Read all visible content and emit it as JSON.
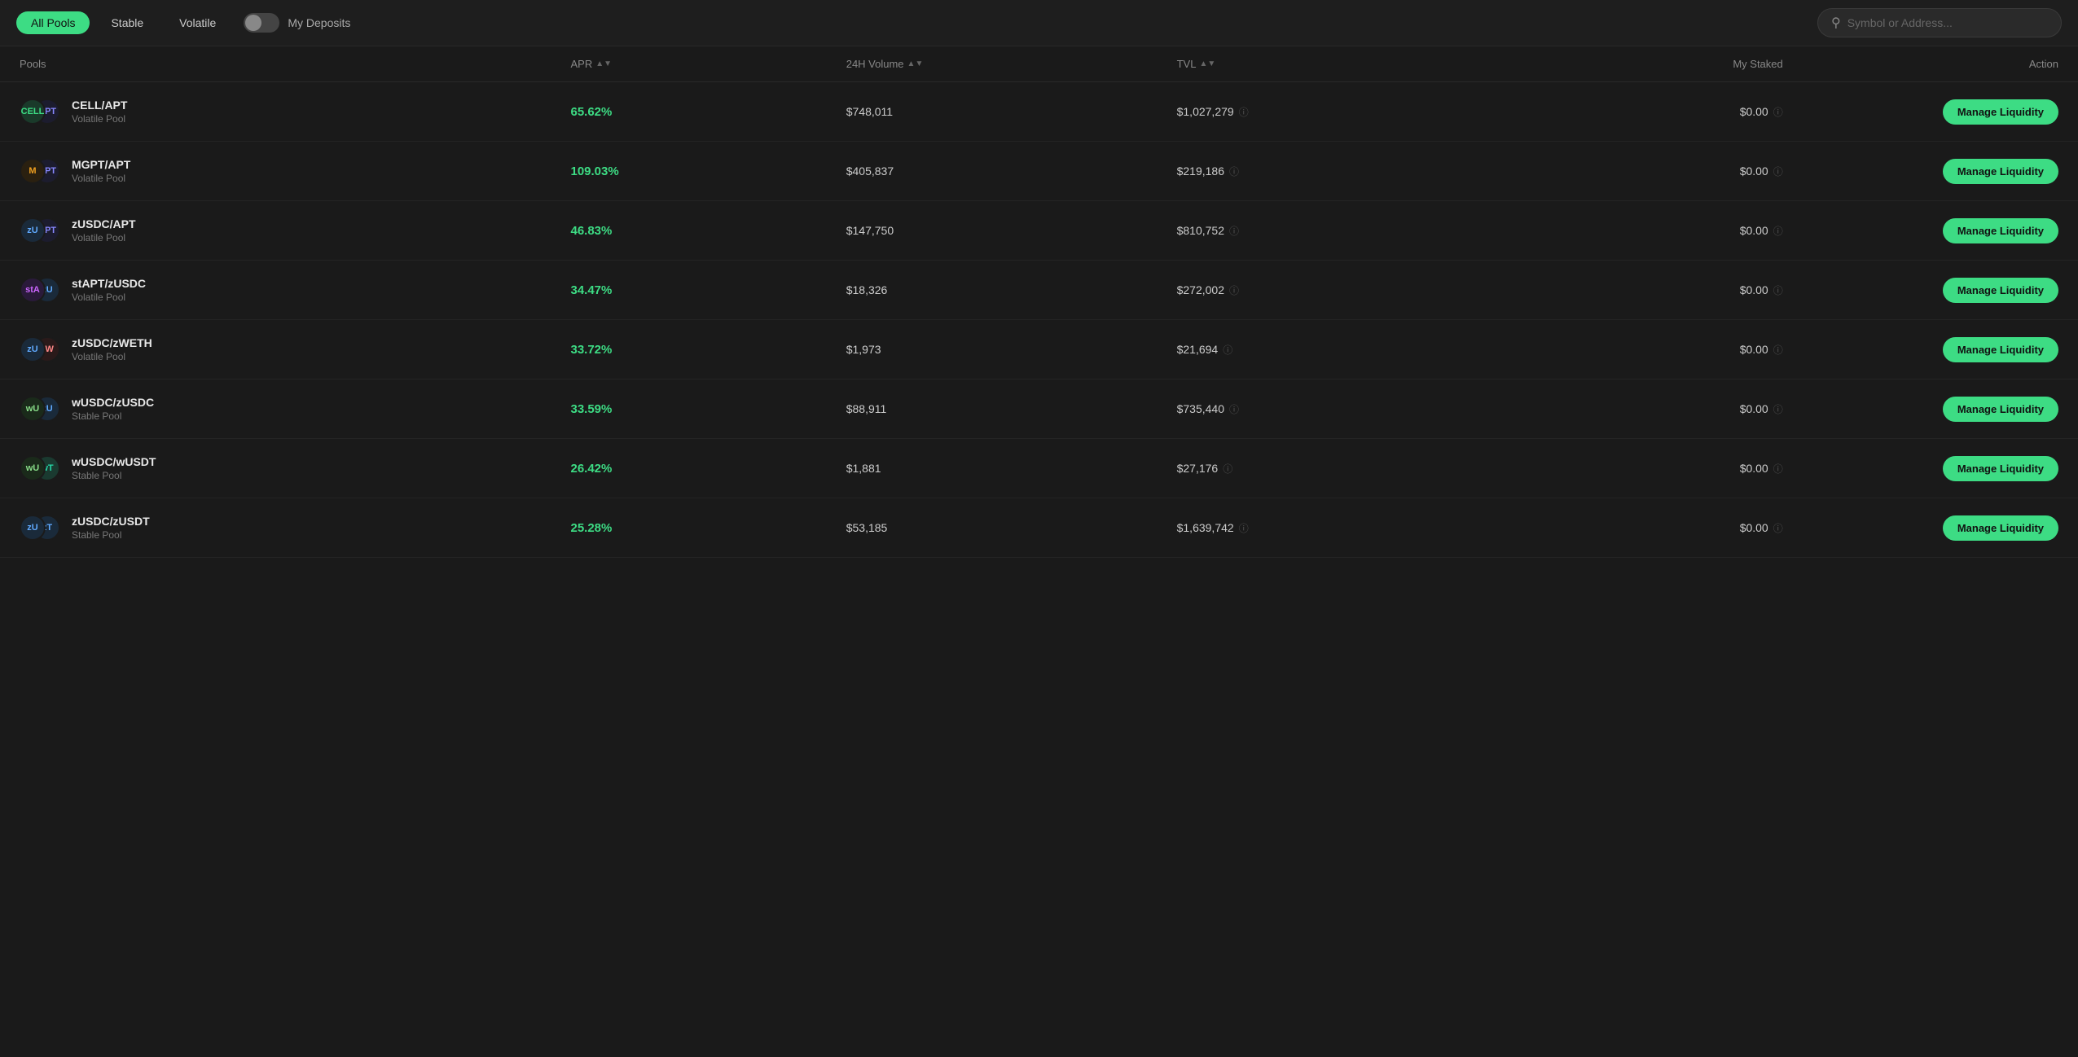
{
  "topbar": {
    "filters": [
      {
        "id": "all-pools",
        "label": "All Pools",
        "active": true
      },
      {
        "id": "stable",
        "label": "Stable",
        "active": false
      },
      {
        "id": "volatile",
        "label": "Volatile",
        "active": false
      }
    ],
    "myDeposits": {
      "label": "My Deposits",
      "toggled": false
    },
    "search": {
      "placeholder": "Symbol or Address..."
    }
  },
  "table": {
    "headers": [
      {
        "id": "pools",
        "label": "Pools",
        "sortable": false
      },
      {
        "id": "apr",
        "label": "APR",
        "sortable": true
      },
      {
        "id": "volume24h",
        "label": "24H Volume",
        "sortable": true
      },
      {
        "id": "tvl",
        "label": "TVL",
        "sortable": true
      },
      {
        "id": "myStaked",
        "label": "My Staked",
        "sortable": false
      },
      {
        "id": "action",
        "label": "Action",
        "sortable": false
      }
    ],
    "rows": [
      {
        "id": "cell-apt",
        "name": "CELL/APT",
        "type": "Volatile Pool",
        "icon1": "CELL",
        "icon2": "APT",
        "icon1Class": "icon-cell",
        "icon2Class": "icon-apt",
        "apr": "65.62%",
        "volume": "$748,011",
        "tvl": "$1,027,279",
        "staked": "$0.00",
        "action": "Manage Liquidity"
      },
      {
        "id": "mgpt-apt",
        "name": "MGPT/APT",
        "type": "Volatile Pool",
        "icon1": "M",
        "icon2": "APT",
        "icon1Class": "icon-mgpt",
        "icon2Class": "icon-apt",
        "apr": "109.03%",
        "volume": "$405,837",
        "tvl": "$219,186",
        "staked": "$0.00",
        "action": "Manage Liquidity"
      },
      {
        "id": "zusdc-apt",
        "name": "zUSDC/APT",
        "type": "Volatile Pool",
        "icon1": "zU",
        "icon2": "APT",
        "icon1Class": "icon-zusdc",
        "icon2Class": "icon-apt",
        "apr": "46.83%",
        "volume": "$147,750",
        "tvl": "$810,752",
        "staked": "$0.00",
        "action": "Manage Liquidity"
      },
      {
        "id": "stapt-zusdc",
        "name": "stAPT/zUSDC",
        "type": "Volatile Pool",
        "icon1": "stA",
        "icon2": "zU",
        "icon1Class": "icon-stapt",
        "icon2Class": "icon-zusdc",
        "apr": "34.47%",
        "volume": "$18,326",
        "tvl": "$272,002",
        "staked": "$0.00",
        "action": "Manage Liquidity"
      },
      {
        "id": "zusdc-zweth",
        "name": "zUSDC/zWETH",
        "type": "Volatile Pool",
        "icon1": "zU",
        "icon2": "zW",
        "icon1Class": "icon-zusdc",
        "icon2Class": "icon-weth",
        "apr": "33.72%",
        "volume": "$1,973",
        "tvl": "$21,694",
        "staked": "$0.00",
        "action": "Manage Liquidity"
      },
      {
        "id": "wusdc-zusdc",
        "name": "wUSDC/zUSDC",
        "type": "Stable Pool",
        "icon1": "wU",
        "icon2": "zU",
        "icon1Class": "icon-wusdc",
        "icon2Class": "icon-zusdc",
        "apr": "33.59%",
        "volume": "$88,911",
        "tvl": "$735,440",
        "staked": "$0.00",
        "action": "Manage Liquidity"
      },
      {
        "id": "wusdc-wusdt",
        "name": "wUSDC/wUSDT",
        "type": "Stable Pool",
        "icon1": "wU",
        "icon2": "wT",
        "icon1Class": "icon-wusdc",
        "icon2Class": "icon-tusdt",
        "apr": "26.42%",
        "volume": "$1,881",
        "tvl": "$27,176",
        "staked": "$0.00",
        "action": "Manage Liquidity"
      },
      {
        "id": "zusdc-zusdt",
        "name": "zUSDC/zUSDT",
        "type": "Stable Pool",
        "icon1": "zU",
        "icon2": "zT",
        "icon1Class": "icon-zusdc",
        "icon2Class": "icon-zusdt",
        "apr": "25.28%",
        "volume": "$53,185",
        "tvl": "$1,639,742",
        "staked": "$0.00",
        "action": "Manage Liquidity"
      }
    ]
  }
}
